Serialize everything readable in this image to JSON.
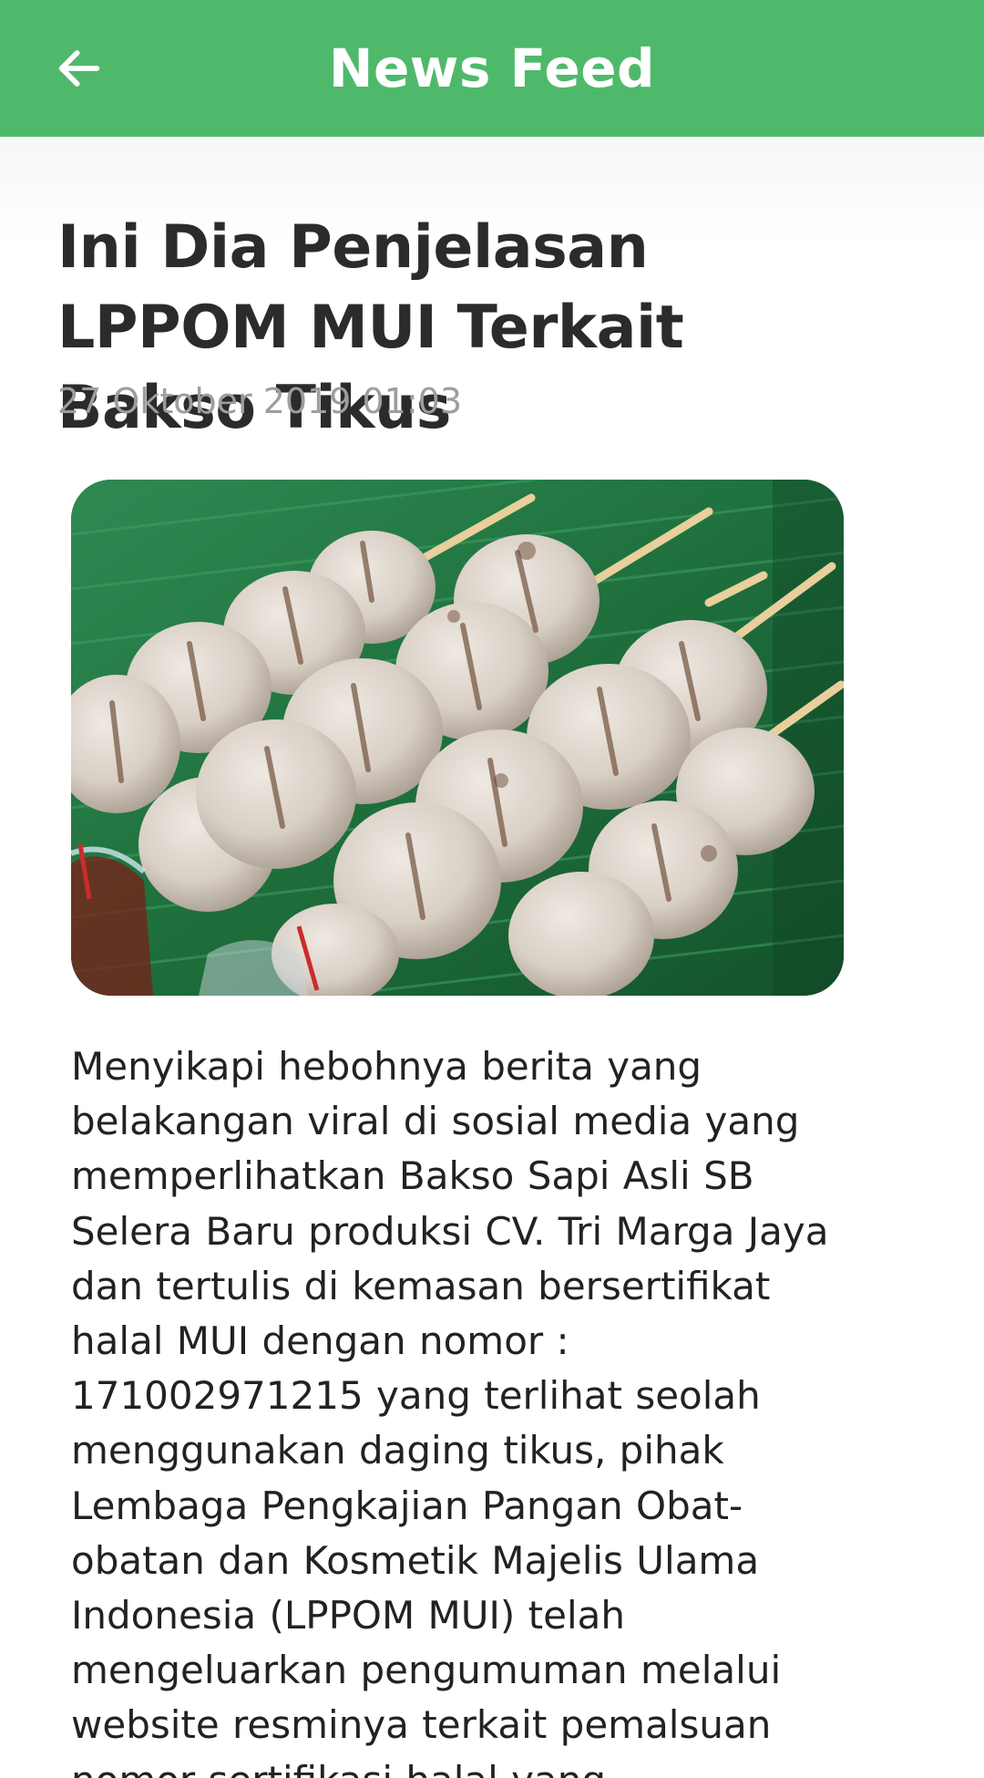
{
  "app_bar": {
    "title": "News Feed",
    "back_icon": "arrow-left-icon"
  },
  "article": {
    "title": "Ini Dia Penjelasan LPPOM MUI Terkait Bakso Tikus",
    "date": "27 Oktober 2019 01:03",
    "image_subject": "grilled meatballs on skewers over banana leaf",
    "body": "Menyikapi hebohnya berita yang belakangan viral di sosial media yang memperlihatkan Bakso Sapi Asli SB Selera Baru produksi CV. Tri Marga Jaya dan tertulis di kemasan bersertifikat halal MUI dengan nomor : 171002971215 yang terlihat seolah menggunakan daging tikus, pihak Lembaga Pengkajian Pangan Obat-obatan dan Kosmetik Majelis Ulama Indonesia (LPPOM MUI) telah mengeluarkan pengumuman melalui website resminya terkait pemalsuan nomor sertifikasi halal yang"
  },
  "colors": {
    "app_bar": "#4fb96b",
    "title_text": "#2b2b2b",
    "date_text": "#9e9e9e",
    "body_text": "#222222"
  }
}
